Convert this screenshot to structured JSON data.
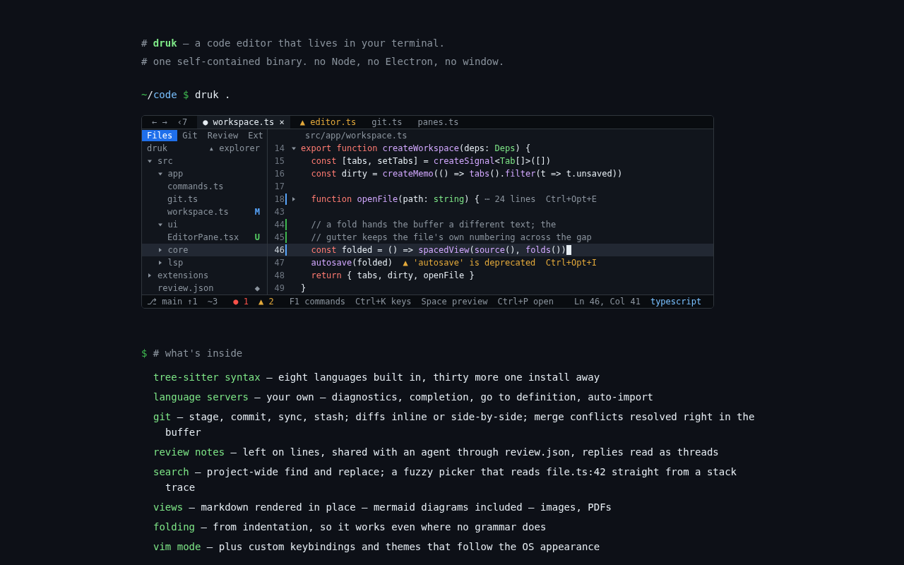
{
  "intro": {
    "lines": [
      "# **druk** — a code editor that lives in your terminal.",
      "# one self-contained binary. no Node, no Electron, no window."
    ],
    "prompt": {
      "home": "~",
      "sep": "/",
      "dir": "code",
      "sigil": "$",
      "command": "druk ."
    }
  },
  "editor": {
    "nav": [
      "←",
      "→"
    ],
    "tab_count": "‹7",
    "tabs": [
      {
        "label": "workspace.ts",
        "selected": true,
        "kind": "modified",
        "mark": "●",
        "close": "×"
      },
      {
        "label": "editor.ts",
        "selected": false,
        "kind": "warning",
        "mark": "▲"
      },
      {
        "label": "git.ts",
        "selected": false,
        "kind": "plain"
      },
      {
        "label": "panes.ts",
        "selected": false,
        "kind": "plain"
      }
    ],
    "sidebar_tabs": [
      {
        "label": "Files",
        "selected": true
      },
      {
        "label": "Git",
        "selected": false
      },
      {
        "label": "Review",
        "selected": false
      },
      {
        "label": "Ext",
        "selected": false
      }
    ],
    "breadcrumb": "src/app/workspace.ts",
    "explorer": {
      "root": "druk",
      "title": "▴ explorer"
    },
    "tree": [
      {
        "name": "src",
        "kind": "folder",
        "expanded": true,
        "selected": false,
        "children": [
          {
            "name": "app",
            "kind": "folder",
            "expanded": true,
            "selected": false,
            "children": [
              {
                "name": "commands.ts",
                "kind": "file",
                "selected": false
              },
              {
                "name": "git.ts",
                "kind": "file",
                "selected": false
              },
              {
                "name": "workspace.ts",
                "kind": "file",
                "selected": false,
                "badge": "M",
                "color": "#58a6ff"
              }
            ]
          },
          {
            "name": "ui",
            "kind": "folder",
            "expanded": true,
            "selected": false,
            "children": [
              {
                "name": "EditorPane.tsx",
                "kind": "file",
                "selected": false,
                "badge": "U",
                "color": "#56d364"
              }
            ]
          },
          {
            "name": "core",
            "kind": "folder",
            "expanded": false,
            "selected": true
          },
          {
            "name": "lsp",
            "kind": "folder",
            "expanded": false,
            "selected": false
          }
        ]
      },
      {
        "name": "extensions",
        "kind": "folder",
        "expanded": false,
        "selected": false
      },
      {
        "name": "review.json",
        "kind": "file",
        "selected": false,
        "badge": "◆",
        "color": "#8b949e"
      }
    ],
    "lines": [
      {
        "number": "14",
        "fold": {
          "expanded": true
        },
        "current": false,
        "tokens": [
          {
            "kind": "kw",
            "text": "export function "
          },
          {
            "kind": "fn",
            "text": "createWorkspace"
          },
          {
            "kind": "plain",
            "text": "(deps: "
          },
          {
            "kind": "type",
            "text": "Deps"
          },
          {
            "kind": "plain",
            "text": ") {"
          }
        ]
      },
      {
        "number": "15",
        "current": false,
        "tokens": [
          {
            "kind": "kw",
            "text": "  const "
          },
          {
            "kind": "plain",
            "text": "[tabs, setTabs] = "
          },
          {
            "kind": "fn",
            "text": "createSignal"
          },
          {
            "kind": "plain",
            "text": "<"
          },
          {
            "kind": "type",
            "text": "Tab"
          },
          {
            "kind": "plain",
            "text": "[]>([])"
          }
        ]
      },
      {
        "number": "16",
        "current": false,
        "tokens": [
          {
            "kind": "kw",
            "text": "  const "
          },
          {
            "kind": "plain",
            "text": "dirty = "
          },
          {
            "kind": "fn",
            "text": "createMemo"
          },
          {
            "kind": "plain",
            "text": "(() => "
          },
          {
            "kind": "fn",
            "text": "tabs"
          },
          {
            "kind": "plain",
            "text": "()."
          },
          {
            "kind": "fn",
            "text": "filter"
          },
          {
            "kind": "plain",
            "text": "(t => t.unsaved))"
          }
        ]
      },
      {
        "number": "17",
        "current": false
      },
      {
        "number": "18",
        "fold": {
          "expanded": false
        },
        "color": "#58a6ff",
        "current": false,
        "tokens": [
          {
            "kind": "kw",
            "text": "  function "
          },
          {
            "kind": "fn",
            "text": "openFile"
          },
          {
            "kind": "plain",
            "text": "(path: "
          },
          {
            "kind": "type",
            "text": "string"
          },
          {
            "kind": "plain",
            "text": ") { "
          },
          {
            "kind": "hint",
            "text": "⋯ 24 lines  Ctrl+Opt+E"
          }
        ]
      },
      {
        "number": "43",
        "current": false
      },
      {
        "number": "44",
        "color": "#3fb950",
        "current": false,
        "tokens": [
          {
            "kind": "comment",
            "text": "  // a fold hands the buffer a different text; the"
          }
        ]
      },
      {
        "number": "45",
        "color": "#3fb950",
        "current": false,
        "tokens": [
          {
            "kind": "comment",
            "text": "  // gutter keeps the file's own numbering across the gap"
          }
        ]
      },
      {
        "number": "46",
        "color": "#58a6ff",
        "current": true,
        "tokens": [
          {
            "kind": "kw",
            "text": "  const "
          },
          {
            "kind": "plain",
            "text": "folded = () => "
          },
          {
            "kind": "fn",
            "text": "spacedView"
          },
          {
            "kind": "plain",
            "text": "("
          },
          {
            "kind": "fn",
            "text": "source"
          },
          {
            "kind": "plain",
            "text": "(), "
          },
          {
            "kind": "fn",
            "text": "folds"
          },
          {
            "kind": "plain",
            "text": "())"
          }
        ]
      },
      {
        "number": "47",
        "current": false,
        "tokens": [
          {
            "kind": "fn",
            "text": "  autosave"
          },
          {
            "kind": "plain",
            "text": "(folded)  "
          },
          {
            "kind": "warn",
            "text": "▲ 'autosave' is deprecated  Ctrl+Opt+I"
          }
        ]
      },
      {
        "number": "48",
        "current": false,
        "tokens": [
          {
            "kind": "kw",
            "text": "  return "
          },
          {
            "kind": "plain",
            "text": "{ tabs, dirty, openFile }"
          }
        ]
      },
      {
        "number": "49",
        "current": false,
        "tokens": [
          {
            "kind": "plain",
            "text": "}"
          }
        ]
      }
    ],
    "status": [
      {
        "kind": "branch",
        "text": "⎇ main ↑1"
      },
      {
        "kind": "plain",
        "text": "~3"
      },
      {
        "kind": "error",
        "text": "● 1"
      },
      {
        "kind": "warning",
        "text": "▲ 2"
      },
      {
        "kind": "key",
        "text": "F1 commands"
      },
      {
        "kind": "key",
        "text": "Ctrl+K keys"
      },
      {
        "kind": "key",
        "text": "Space preview"
      },
      {
        "kind": "key",
        "text": "Ctrl+P open"
      },
      {
        "kind": "position",
        "text": "Ln 46, Col 41"
      },
      {
        "kind": "language",
        "text": "typescript"
      }
    ]
  },
  "inside": {
    "sigil": "$",
    "text": "# what's inside",
    "features": [
      {
        "term": "tree-sitter syntax",
        "text": "— eight languages built in, thirty more one install away"
      },
      {
        "term": "language servers",
        "text": "— your own — diagnostics, completion, go to definition, auto-import"
      },
      {
        "term": "git",
        "text": "— stage, commit, sync, stash; diffs inline or side-by-side; merge conflicts resolved right in the buffer"
      },
      {
        "term": "review notes",
        "text": "— left on lines, shared with an agent through review.json, replies read as threads"
      },
      {
        "term": "search",
        "text": "— project-wide find and replace; a fuzzy picker that reads file.ts:42 straight from a stack trace"
      },
      {
        "term": "views",
        "text": "— markdown rendered in place — mermaid diagrams included — images, PDFs"
      },
      {
        "term": "folding",
        "text": "— from indentation, so it works even where no grammar does"
      },
      {
        "term": "vim mode",
        "text": "— plus custom keybindings and themes that follow the OS appearance"
      }
    ]
  }
}
